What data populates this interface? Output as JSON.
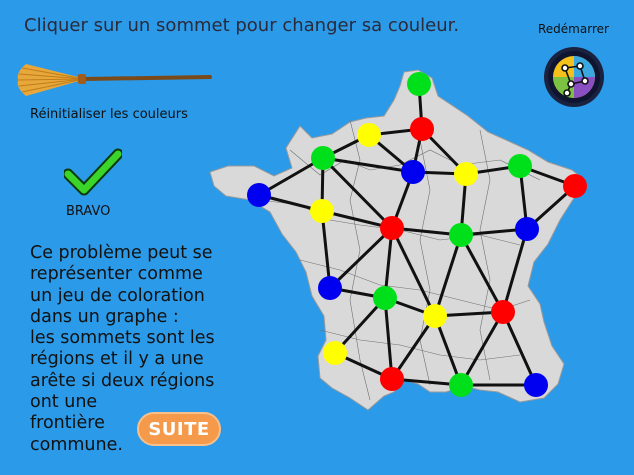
{
  "header": {
    "instruction": "Cliquer sur un sommet pour changer sa couleur.",
    "restart_label": "Redémarrer"
  },
  "tools": {
    "reset_label": "Réinitialiser les couleurs",
    "success_label": "BRAVO"
  },
  "explanation": {
    "lines": [
      "Ce problème peut se",
      "représenter  comme",
      "un jeu de  coloration",
      "dans   un   graphe :",
      "les sommets sont les",
      "régions et  il y  a  une",
      "arête si deux régions",
      "ont      une",
      "frontière",
      "commune."
    ]
  },
  "next_button": {
    "label": "SUITE"
  },
  "colors": {
    "background": "#2b9ae8",
    "map": "#d9d9d9",
    "red": "#ff0000",
    "green": "#00e01a",
    "blue": "#0000f0",
    "yellow": "#ffff00",
    "button": "#f59a4a"
  },
  "graph": {
    "vertices": [
      {
        "id": "v1",
        "color": "green"
      },
      {
        "id": "v2",
        "color": "red"
      },
      {
        "id": "v3",
        "color": "yellow"
      },
      {
        "id": "v4",
        "color": "green"
      },
      {
        "id": "v5",
        "color": "blue"
      },
      {
        "id": "v6",
        "color": "yellow"
      },
      {
        "id": "v7",
        "color": "green"
      },
      {
        "id": "v8",
        "color": "red"
      },
      {
        "id": "v9",
        "color": "blue"
      },
      {
        "id": "v10",
        "color": "yellow"
      },
      {
        "id": "v11",
        "color": "red"
      },
      {
        "id": "v12",
        "color": "green"
      },
      {
        "id": "v13",
        "color": "blue"
      },
      {
        "id": "v14",
        "color": "blue"
      },
      {
        "id": "v15",
        "color": "green"
      },
      {
        "id": "v16",
        "color": "yellow"
      },
      {
        "id": "v17",
        "color": "red"
      },
      {
        "id": "v18",
        "color": "yellow"
      },
      {
        "id": "v19",
        "color": "red"
      },
      {
        "id": "v20",
        "color": "green"
      },
      {
        "id": "v21",
        "color": "blue"
      }
    ],
    "edges": [
      [
        "v1",
        "v2"
      ],
      [
        "v2",
        "v3"
      ],
      [
        "v2",
        "v5"
      ],
      [
        "v2",
        "v6"
      ],
      [
        "v3",
        "v4"
      ],
      [
        "v3",
        "v5"
      ],
      [
        "v4",
        "v5"
      ],
      [
        "v4",
        "v9"
      ],
      [
        "v4",
        "v10"
      ],
      [
        "v4",
        "v11"
      ],
      [
        "v5",
        "v6"
      ],
      [
        "v5",
        "v11"
      ],
      [
        "v6",
        "v7"
      ],
      [
        "v6",
        "v12"
      ],
      [
        "v7",
        "v8"
      ],
      [
        "v7",
        "v13"
      ],
      [
        "v8",
        "v13"
      ],
      [
        "v9",
        "v10"
      ],
      [
        "v10",
        "v11"
      ],
      [
        "v10",
        "v14"
      ],
      [
        "v11",
        "v14"
      ],
      [
        "v11",
        "v15"
      ],
      [
        "v11",
        "v16"
      ],
      [
        "v11",
        "v12"
      ],
      [
        "v12",
        "v13"
      ],
      [
        "v12",
        "v16"
      ],
      [
        "v12",
        "v17"
      ],
      [
        "v13",
        "v17"
      ],
      [
        "v14",
        "v15"
      ],
      [
        "v15",
        "v16"
      ],
      [
        "v15",
        "v18"
      ],
      [
        "v15",
        "v19"
      ],
      [
        "v16",
        "v19"
      ],
      [
        "v16",
        "v20"
      ],
      [
        "v16",
        "v17"
      ],
      [
        "v17",
        "v20"
      ],
      [
        "v17",
        "v21"
      ],
      [
        "v18",
        "v19"
      ],
      [
        "v19",
        "v20"
      ],
      [
        "v20",
        "v21"
      ]
    ]
  }
}
